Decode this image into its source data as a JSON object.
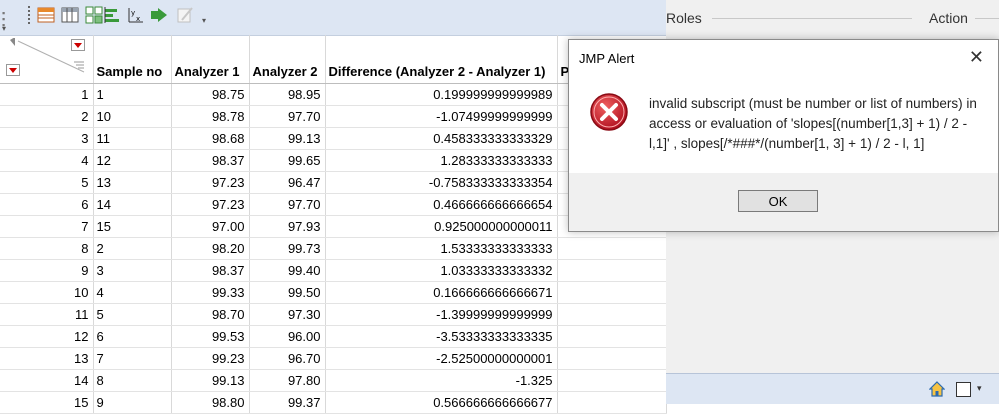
{
  "table": {
    "columns": [
      "Sample no",
      "Analyzer 1",
      "Analyzer 2",
      "Difference (Analyzer 2 - Analyzer 1)",
      "P"
    ],
    "rows": [
      {
        "n": "1",
        "sample": "1",
        "a1": "98.75",
        "a2": "98.95",
        "diff": "0.199999999999989"
      },
      {
        "n": "2",
        "sample": "10",
        "a1": "98.78",
        "a2": "97.70",
        "diff": "-1.07499999999999"
      },
      {
        "n": "3",
        "sample": "11",
        "a1": "98.68",
        "a2": "99.13",
        "diff": "0.458333333333329"
      },
      {
        "n": "4",
        "sample": "12",
        "a1": "98.37",
        "a2": "99.65",
        "diff": "1.28333333333333"
      },
      {
        "n": "5",
        "sample": "13",
        "a1": "97.23",
        "a2": "96.47",
        "diff": "-0.758333333333354"
      },
      {
        "n": "6",
        "sample": "14",
        "a1": "97.23",
        "a2": "97.70",
        "diff": "0.466666666666654"
      },
      {
        "n": "7",
        "sample": "15",
        "a1": "97.00",
        "a2": "97.93",
        "diff": "0.925000000000011"
      },
      {
        "n": "8",
        "sample": "2",
        "a1": "98.20",
        "a2": "99.73",
        "diff": "1.53333333333333"
      },
      {
        "n": "9",
        "sample": "3",
        "a1": "98.37",
        "a2": "99.40",
        "diff": "1.03333333333332"
      },
      {
        "n": "10",
        "sample": "4",
        "a1": "99.33",
        "a2": "99.50",
        "diff": "0.166666666666671"
      },
      {
        "n": "11",
        "sample": "5",
        "a1": "98.70",
        "a2": "97.30",
        "diff": "-1.39999999999999"
      },
      {
        "n": "12",
        "sample": "6",
        "a1": "99.53",
        "a2": "96.00",
        "diff": "-3.53333333333335"
      },
      {
        "n": "13",
        "sample": "7",
        "a1": "99.23",
        "a2": "96.70",
        "diff": "-2.52500000000001"
      },
      {
        "n": "14",
        "sample": "8",
        "a1": "99.13",
        "a2": "97.80",
        "diff": "-1.325"
      },
      {
        "n": "15",
        "sample": "9",
        "a1": "98.80",
        "a2": "99.37",
        "diff": "0.566666666666677"
      }
    ]
  },
  "right_panel": {
    "roles_label": "Roles",
    "action_label": "Action"
  },
  "dialog": {
    "title": "JMP Alert",
    "close_glyph": "✕",
    "message": "invalid subscript (must be number or list of numbers) in access or evaluation of 'slopes[(number[1,3] + 1) / 2 - l,1]' , slopes[/*###*/(number[1, 3] + 1) / 2 - l, 1]",
    "ok_label": "OK"
  },
  "icons": {
    "error": "error-x-icon",
    "home": "home-icon",
    "checkbox": "checkbox-icon"
  },
  "colors": {
    "error_red": "#c8102e",
    "toolbar_bg": "#dde6f3",
    "table_red_triangle": "#cc0000"
  }
}
